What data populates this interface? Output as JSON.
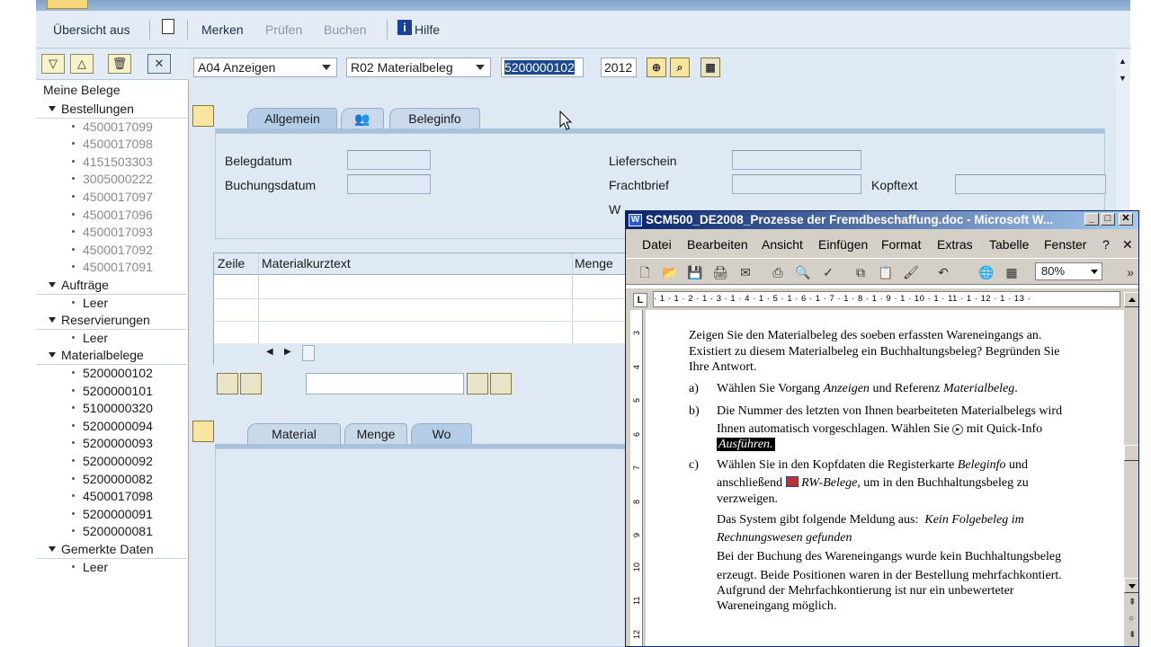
{
  "app": {
    "menu": {
      "overview_label": "Übersicht aus",
      "merken_label": "Merken",
      "pruefen_label": "Prüfen",
      "buchen_label": "Buchen",
      "hilfe_label": "Hilfe"
    }
  },
  "navigator": {
    "header": "Meine Belege",
    "groups": [
      {
        "label": "Bestellungen",
        "items": [
          "4500017099",
          "4500017098",
          "4151503303",
          "3005000222",
          "4500017097",
          "4500017096",
          "4500017093",
          "4500017092",
          "4500017091"
        ]
      },
      {
        "label": "Aufträge",
        "items": [
          "Leer"
        ]
      },
      {
        "label": "Reservierungen",
        "items": [
          "Leer"
        ]
      },
      {
        "label": "Materialbelege",
        "items": [
          "5200000102",
          "5200000101",
          "5100000320",
          "5200000094",
          "5200000093",
          "5200000092",
          "5200000082",
          "4500017098",
          "5200000091",
          "5200000081"
        ]
      },
      {
        "label": "Gemerkte Daten",
        "items": [
          "Leer"
        ]
      }
    ]
  },
  "main": {
    "action_select": "A04 Anzeigen",
    "reference_select": "R02 Materialbeleg",
    "document_number": "5200000102",
    "year": "2012",
    "header_tabs": [
      "Allgemein",
      "",
      "Beleginfo"
    ],
    "fields": {
      "belegdatum": "Belegdatum",
      "buchungsdatum": "Buchungsdatum",
      "lieferschein": "Lieferschein",
      "frachtbrief": "Frachtbrief",
      "kopftext": "Kopftext",
      "hidden_label_fragment": "W"
    },
    "grid_columns": [
      "Zeile",
      "Materialkurztext",
      "Menge"
    ],
    "detail_tabs": [
      "Material",
      "Menge",
      "Wo"
    ]
  },
  "word": {
    "title": "SCM500_DE2008_Prozesse der Fremdbeschaffung.doc - Microsoft W...",
    "menus": [
      "Datei",
      "Bearbeiten",
      "Ansicht",
      "Einfügen",
      "Format",
      "Extras",
      "Tabelle",
      "Fenster",
      "?"
    ],
    "zoom": "80%",
    "ruler_text": "· 1 · 1 · 2 · 1 · 3 · 1 · 4 · 1 · 5 · 1 · 6 · 1 · 7 · 1 · 8 · 1 · 9 · 1 · 10 · 1 · 11 · 1 · 12 · 1 · 13 ·",
    "vruler_ticks": [
      "3",
      "4",
      "5",
      "6",
      "7",
      "8",
      "9",
      "10",
      "11",
      "12"
    ],
    "doc": {
      "intro_1": "Zeigen Sie den Materialbeleg des soeben erfassten Wareneingangs an.",
      "intro_2": "Existiert zu diesem Materialbeleg ein Buchhaltungsbeleg? Begründen Sie",
      "intro_3": "Ihre Antwort.",
      "a_label": "a)",
      "a_text_1": "Wählen Sie Vorgang",
      "a_italic_1": "Anzeigen",
      "a_text_2": "und Referenz",
      "a_italic_2": "Materialbeleg",
      "a_text_3": ".",
      "b_label": "b)",
      "b_line_1": "Die Nummer des letzten von Ihnen bearbeiteten Materialbelegs wird",
      "b_line_2": "Ihnen automatisch vorgeschlagen. Wählen Sie",
      "b_line_2b": "mit Quick-Info",
      "b_line_3": "Ausführen.",
      "c_label": "c)",
      "c_line_1a": "Wählen Sie in den Kopfdaten die Registerkarte",
      "c_line_1i": "Beleginfo",
      "c_line_1b": "und",
      "c_line_2a": "anschließend",
      "c_line_2i": "RW-Belege",
      "c_line_2b": ", um in den Buchhaltungsbeleg zu",
      "c_line_3": "verzweigen.",
      "msg_1a": "Das System gibt folgende Meldung aus:",
      "msg_1i": "Kein Folgebeleg im",
      "msg_2i": "Rechnungswesen gefunden",
      "end_1": "Bei der Buchung des Wareneingangs wurde kein Buchhaltungsbeleg",
      "end_2": "erzeugt. Beide Positionen waren in der Bestellung mehrfachkontiert.",
      "end_3": "Aufgrund der Mehrfachkontierung ist nur ein unbewerteter",
      "end_4": "Wareneingang möglich."
    }
  }
}
